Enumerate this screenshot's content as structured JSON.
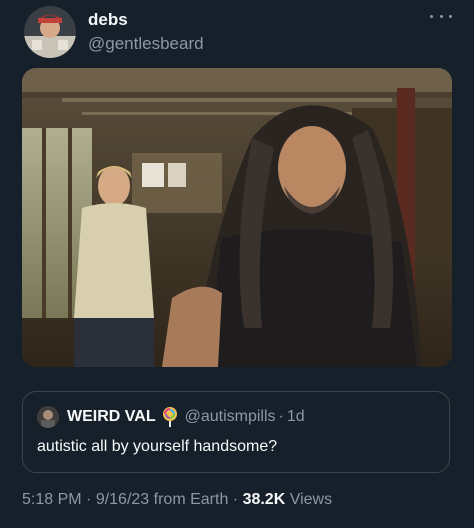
{
  "author": {
    "display_name": "debs",
    "handle": "@gentlesbeard"
  },
  "quoted_tweet": {
    "display_name": "WEIRD VAL",
    "emoji": "lollipop-icon",
    "handle": "@autismpills",
    "separator": "·",
    "time": "1d",
    "text": "autistic all by yourself handsome?"
  },
  "meta": {
    "time": "5:18 PM",
    "sep1": " · ",
    "date": "9/16/23",
    "source": " from Earth",
    "sep2": " · ",
    "views_count": "38.2K",
    "views_label": " Views"
  },
  "colors": {
    "background": "#15202b",
    "primary_text": "#f7f9f9",
    "secondary_text": "#8b98a5",
    "border": "#38444d"
  }
}
